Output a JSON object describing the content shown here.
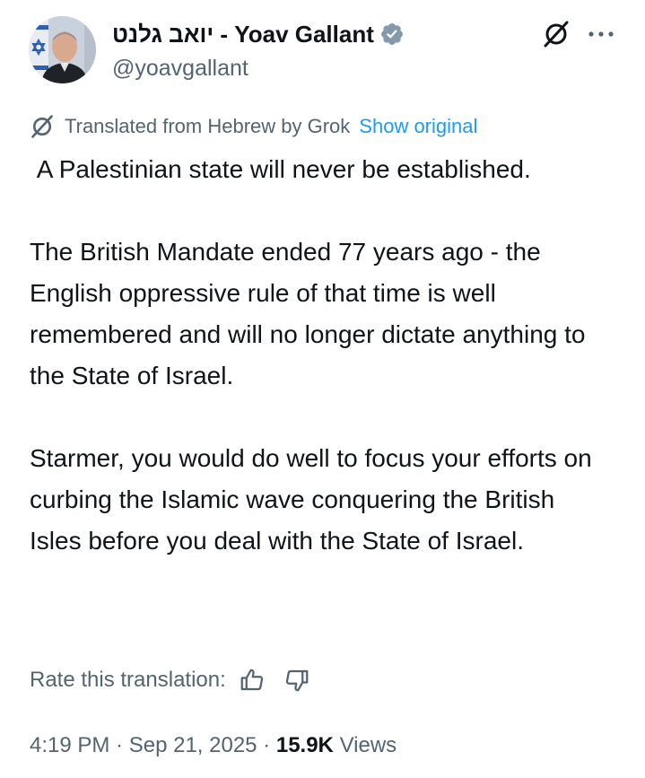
{
  "author": {
    "display_name": "יואב גלנט - Yoav Gallant",
    "handle": "@yoavgallant",
    "verified_icon": "verified-badge-icon",
    "avatar": "avatar"
  },
  "actions": {
    "grok_icon": "grok-icon",
    "more_icon": "more-dots-icon"
  },
  "translation": {
    "notice": "Translated from Hebrew by Grok",
    "show_original": "Show original",
    "rate_label": "Rate this translation:",
    "thumbs_up_icon": "thumbs-up-icon",
    "thumbs_down_icon": "thumbs-down-icon"
  },
  "tweet": {
    "paragraphs": [
      " A Palestinian state will never be established.",
      "The British Mandate ended 77 years ago - the English oppressive rule of that time is well remembered and will no longer dictate anything to the State of Israel.",
      "Starmer, you would do well to focus your efforts on curbing the Islamic wave conquering the British Isles before you deal with the State of Israel."
    ]
  },
  "meta": {
    "time": "4:19 PM",
    "separator": " · ",
    "date": "Sep 21, 2025",
    "views_count": "15.9K",
    "views_label": "Views"
  },
  "colors": {
    "text": "#0f1419",
    "secondary": "#536471",
    "link": "#1d9bf0",
    "verified": "#829aab"
  }
}
